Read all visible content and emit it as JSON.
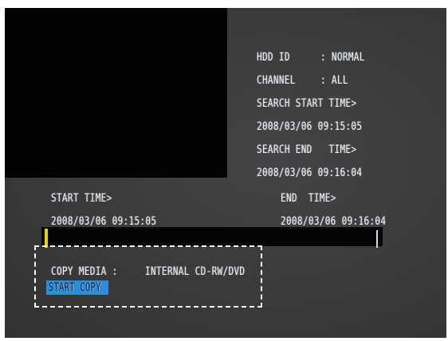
{
  "hdd_panel": {
    "hdd_id_label": "HDD ID",
    "hdd_id_value": ": NORMAL",
    "channel_label": "CHANNEL",
    "channel_value": ": ALL",
    "search_start_label": "SEARCH START TIME>",
    "search_start_value": "2008/03/06 09:15:05",
    "search_end_label": "SEARCH END   TIME>",
    "search_end_value": "2008/03/06 09:16:04"
  },
  "range": {
    "start_label": "START TIME>",
    "start_value": "2008/03/06 09:15:05",
    "end_label": "END  TIME>",
    "end_value": "2008/03/06 09:16:04"
  },
  "copy": {
    "media_label": "COPY MEDIA :",
    "media_value": "INTERNAL CD-RW/DVD",
    "start_button_label": "START COPY"
  },
  "colors": {
    "osd_text": "#f2f2f2",
    "button_highlight": "#2a8fd8",
    "timeline_marker_start": "#e3d400",
    "timeline_marker_end": "#d0dcea",
    "dashed_border": "#ffffff"
  }
}
